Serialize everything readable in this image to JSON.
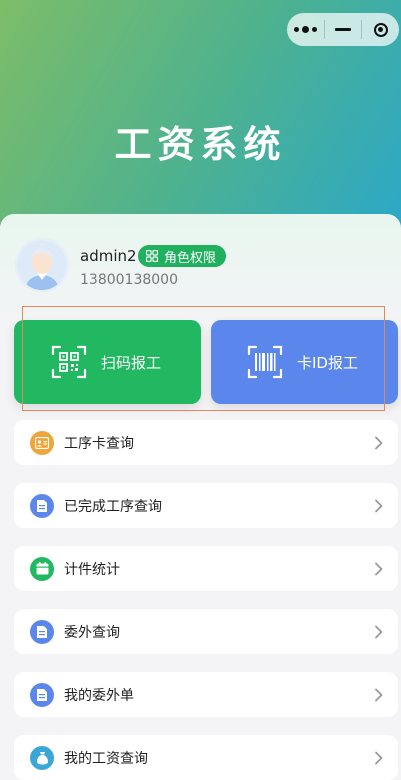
{
  "app": {
    "title": "工资系统"
  },
  "user": {
    "name": "admin2",
    "role_label": "角色权限",
    "phone": "13800138000"
  },
  "actions": [
    {
      "label": "扫码报工",
      "icon": "qr-scan-icon",
      "color": "#22b862"
    },
    {
      "label": "卡ID报工",
      "icon": "barcode-scan-icon",
      "color": "#5b87ec"
    }
  ],
  "menu": [
    {
      "label": "工序卡查询",
      "icon": "id-card-icon",
      "color": "#f0a53a"
    },
    {
      "label": "已完成工序查询",
      "icon": "document-icon",
      "color": "#5b87ec"
    },
    {
      "label": "计件统计",
      "icon": "calendar-icon",
      "color": "#22b862"
    },
    {
      "label": "委外查询",
      "icon": "document-icon",
      "color": "#5b87ec"
    },
    {
      "label": "我的委外单",
      "icon": "document-icon",
      "color": "#5b87ec"
    },
    {
      "label": "我的工资查询",
      "icon": "money-bag-icon",
      "color": "#3aa7d6"
    }
  ]
}
